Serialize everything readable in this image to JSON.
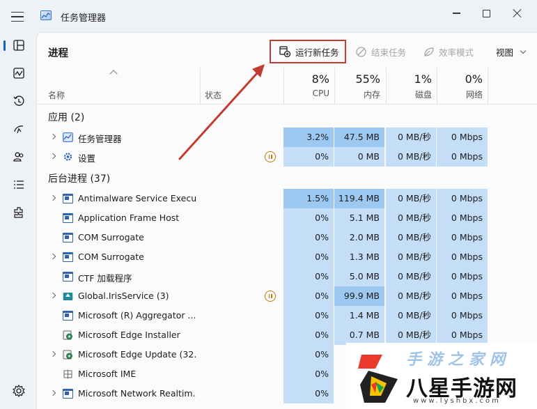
{
  "window": {
    "title": "任务管理器"
  },
  "nav": {
    "items": [
      {
        "icon": "processes-icon"
      },
      {
        "icon": "performance-icon"
      },
      {
        "icon": "app-history-icon"
      },
      {
        "icon": "startup-apps-icon"
      },
      {
        "icon": "users-icon"
      },
      {
        "icon": "details-icon"
      },
      {
        "icon": "services-icon"
      }
    ],
    "settings_icon": "gear-icon"
  },
  "toolbar": {
    "page_title": "进程",
    "run_new_task": "运行新任务",
    "end_task": "结束任务",
    "efficiency_mode": "效率模式",
    "view": "视图"
  },
  "columns": {
    "name": "名称",
    "status": "状态",
    "cpu": {
      "pct": "8%",
      "label": "CPU"
    },
    "memory": {
      "pct": "55%",
      "label": "内存"
    },
    "disk": {
      "pct": "1%",
      "label": "磁盘"
    },
    "network": {
      "pct": "0%",
      "label": "网络"
    }
  },
  "groups": {
    "apps": {
      "label": "应用 (2)",
      "rows": [
        {
          "name": "任务管理器",
          "cpu": "3.2%",
          "mem": "47.5 MB",
          "disk": "0 MB/秒",
          "net": "0 Mbps"
        },
        {
          "name": "设置",
          "cpu": "0%",
          "mem": "0 MB",
          "disk": "0 MB/秒",
          "net": "0 Mbps"
        }
      ]
    },
    "background": {
      "label": "后台进程 (37)",
      "rows": [
        {
          "name": "Antimalware Service Execut...",
          "cpu": "1.5%",
          "mem": "119.4 MB",
          "disk": "0 MB/秒",
          "net": "0 Mbps"
        },
        {
          "name": "Application Frame Host",
          "cpu": "0%",
          "mem": "5.1 MB",
          "disk": "0 MB/秒",
          "net": "0 Mbps"
        },
        {
          "name": "COM Surrogate",
          "cpu": "0%",
          "mem": "2.0 MB",
          "disk": "0 MB/秒",
          "net": "0 Mbps"
        },
        {
          "name": "COM Surrogate",
          "cpu": "0%",
          "mem": "1.3 MB",
          "disk": "0 MB/秒",
          "net": "0 Mbps"
        },
        {
          "name": "CTF 加载程序",
          "cpu": "0%",
          "mem": "5.0 MB",
          "disk": "0 MB/秒",
          "net": "0 Mbps"
        },
        {
          "name": "Global.IrisService (3)",
          "cpu": "0%",
          "mem": "99.9 MB",
          "disk": "0 MB/秒",
          "net": "0 Mbps"
        },
        {
          "name": "Microsoft (R) Aggregator ...",
          "cpu": "0%",
          "mem": "1.4 MB",
          "disk": "0 MB/秒",
          "net": "0 Mbps"
        },
        {
          "name": "Microsoft Edge Installer",
          "cpu": "0%",
          "mem": "0.7 MB",
          "disk": "0 MB/秒",
          "net": "0 Mbps"
        },
        {
          "name": "Microsoft Edge Update (32...",
          "cpu": "0%",
          "mem": "",
          "disk": "",
          "net": ""
        },
        {
          "name": "Microsoft IME",
          "cpu": "0%",
          "mem": "",
          "disk": "",
          "net": ""
        },
        {
          "name": "Microsoft Network Realtim...",
          "cpu": "0%",
          "mem": "",
          "disk": "",
          "net": ""
        }
      ]
    }
  },
  "watermark": {
    "top": "手游之家网",
    "name": "八星手游网",
    "url": "www.lyshbx.com"
  },
  "colors": {
    "annotation": "#c23b2e",
    "accent": "#0b63c5",
    "heat_high": "#9dc8f2",
    "heat_mid": "#c4def7",
    "heat_low": "#d9eafb"
  }
}
